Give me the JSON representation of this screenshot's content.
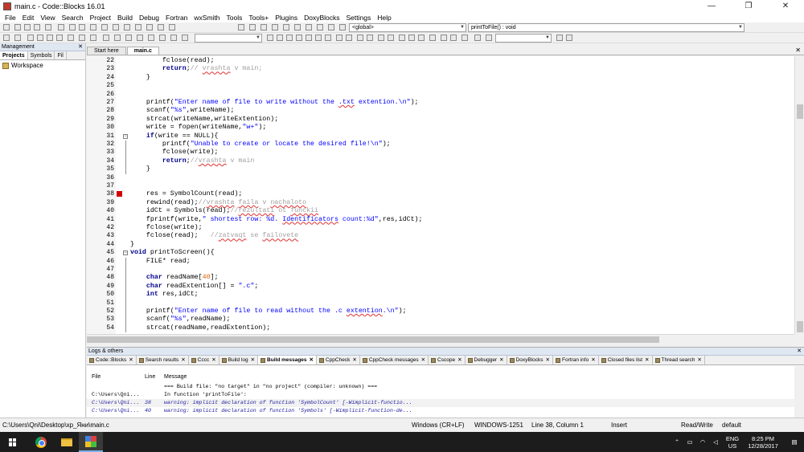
{
  "window": {
    "title": "main.c - Code::Blocks 16.01",
    "minimize": "—",
    "maximize": "❐",
    "close": "✕"
  },
  "menu": [
    "File",
    "Edit",
    "View",
    "Search",
    "Project",
    "Build",
    "Debug",
    "Fortran",
    "wxSmith",
    "Tools",
    "Tools+",
    "Plugins",
    "DoxyBlocks",
    "Settings",
    "Help"
  ],
  "toolbar": {
    "scope_combo": "<global>",
    "function_combo": "printToFile() : void"
  },
  "management": {
    "title": "Management",
    "tabs": [
      "Projects",
      "Symbols",
      "Fil"
    ],
    "active_tab": "Projects",
    "workspace": "Workspace"
  },
  "editor": {
    "tabs": [
      "Start here",
      "main.c"
    ],
    "active_tab": "main.c",
    "breakpoint_line": 38,
    "lines": [
      {
        "n": "22",
        "segs": [
          [
            "t",
            "        fclose(read);"
          ]
        ]
      },
      {
        "n": "23",
        "segs": [
          [
            "kw",
            "        return"
          ],
          [
            "t",
            ";"
          ],
          [
            "cm",
            "// "
          ],
          [
            "cme",
            "vrashta"
          ],
          [
            "cm",
            " v main;"
          ]
        ]
      },
      {
        "n": "24",
        "segs": [
          [
            "t",
            "    }"
          ]
        ]
      },
      {
        "n": "25",
        "segs": [
          [
            "t",
            ""
          ]
        ]
      },
      {
        "n": "26",
        "segs": [
          [
            "t",
            ""
          ]
        ]
      },
      {
        "n": "27",
        "segs": [
          [
            "t",
            "    printf("
          ],
          [
            "str",
            "\"Enter name of file to write without the "
          ],
          [
            "stre",
            ".txt"
          ],
          [
            "str",
            " extention.\\n\""
          ],
          [
            "t",
            ");"
          ]
        ]
      },
      {
        "n": "28",
        "segs": [
          [
            "t",
            "    scanf("
          ],
          [
            "str",
            "\"%s\""
          ],
          [
            "t",
            ",writeName);"
          ]
        ]
      },
      {
        "n": "29",
        "segs": [
          [
            "t",
            "    strcat(writeName,writeExtention);"
          ]
        ]
      },
      {
        "n": "30",
        "segs": [
          [
            "t",
            "    write = fopen(writeName,"
          ],
          [
            "str",
            "\"w+\""
          ],
          [
            "t",
            ");"
          ]
        ]
      },
      {
        "n": "31",
        "segs": [
          [
            "kw",
            "    if"
          ],
          [
            "t",
            "(write == NULL){"
          ]
        ]
      },
      {
        "n": "32",
        "segs": [
          [
            "t",
            "        printf("
          ],
          [
            "str",
            "\"Unable to create or locate the desired file!\\n\""
          ],
          [
            "t",
            ");"
          ]
        ]
      },
      {
        "n": "33",
        "segs": [
          [
            "t",
            "        fclose(write);"
          ]
        ]
      },
      {
        "n": "34",
        "segs": [
          [
            "kw",
            "        return"
          ],
          [
            "t",
            ";"
          ],
          [
            "cm",
            "//"
          ],
          [
            "cme",
            "vrashta"
          ],
          [
            "cm",
            " v main"
          ]
        ]
      },
      {
        "n": "35",
        "segs": [
          [
            "t",
            "    }"
          ]
        ]
      },
      {
        "n": "36",
        "segs": [
          [
            "t",
            ""
          ]
        ]
      },
      {
        "n": "37",
        "segs": [
          [
            "t",
            ""
          ]
        ]
      },
      {
        "n": "38",
        "segs": [
          [
            "t",
            "    res = SymbolCount(read);"
          ]
        ]
      },
      {
        "n": "39",
        "segs": [
          [
            "t",
            "    rewind(read);"
          ],
          [
            "cm",
            "//"
          ],
          [
            "cme",
            "vrashta"
          ],
          [
            "cm",
            " "
          ],
          [
            "cme",
            "faila"
          ],
          [
            "cm",
            " v "
          ],
          [
            "cme",
            "nachaloto"
          ]
        ]
      },
      {
        "n": "40",
        "segs": [
          [
            "t",
            "    idCt = Symbols(read);"
          ],
          [
            "cm",
            "//"
          ],
          [
            "cme",
            "rezultati"
          ],
          [
            "cm",
            " ot "
          ],
          [
            "cme",
            "funckii"
          ]
        ]
      },
      {
        "n": "41",
        "segs": [
          [
            "t",
            "    fprintf(write,"
          ],
          [
            "str",
            "\" shortest row: %d. "
          ],
          [
            "stre",
            "Identificators"
          ],
          [
            "str",
            " count:%d\""
          ],
          [
            "t",
            ",res,idCt);"
          ]
        ]
      },
      {
        "n": "42",
        "segs": [
          [
            "t",
            "    fclose(write);"
          ]
        ]
      },
      {
        "n": "43",
        "segs": [
          [
            "t",
            "    fclose(read);   "
          ],
          [
            "cm",
            "//"
          ],
          [
            "cme",
            "zatvaqt"
          ],
          [
            "cm",
            " se "
          ],
          [
            "cme",
            "failovete"
          ]
        ]
      },
      {
        "n": "44",
        "segs": [
          [
            "t",
            "}"
          ]
        ]
      },
      {
        "n": "45",
        "segs": [
          [
            "kw",
            "void"
          ],
          [
            "t",
            " printToScreen(){"
          ]
        ]
      },
      {
        "n": "46",
        "segs": [
          [
            "t",
            "    FILE* read;"
          ]
        ]
      },
      {
        "n": "47",
        "segs": [
          [
            "t",
            ""
          ]
        ]
      },
      {
        "n": "48",
        "segs": [
          [
            "kw",
            "    char"
          ],
          [
            "t",
            " readName["
          ],
          [
            "num",
            "40"
          ],
          [
            "t",
            "];"
          ]
        ]
      },
      {
        "n": "49",
        "segs": [
          [
            "kw",
            "    char"
          ],
          [
            "t",
            " readExtention[] = "
          ],
          [
            "str",
            "\".c\""
          ],
          [
            "t",
            ";"
          ]
        ]
      },
      {
        "n": "50",
        "segs": [
          [
            "kw",
            "    int"
          ],
          [
            "t",
            " res,idCt;"
          ]
        ]
      },
      {
        "n": "51",
        "segs": [
          [
            "t",
            ""
          ]
        ]
      },
      {
        "n": "52",
        "segs": [
          [
            "t",
            "    printf("
          ],
          [
            "str",
            "\"Enter name of file to read without the .c "
          ],
          [
            "stre",
            "extention"
          ],
          [
            "str",
            ".\\n\""
          ],
          [
            "t",
            ");"
          ]
        ]
      },
      {
        "n": "53",
        "segs": [
          [
            "t",
            "    scanf("
          ],
          [
            "str",
            "\"%s\""
          ],
          [
            "t",
            ",readName);"
          ]
        ]
      },
      {
        "n": "54",
        "segs": [
          [
            "t",
            "    strcat(readName,readExtention);"
          ]
        ]
      }
    ]
  },
  "logs": {
    "title": "Logs & others",
    "tabs": [
      "Code::Blocks",
      "Search results",
      "Cccc",
      "Build log",
      "Build messages",
      "CppCheck",
      "CppCheck messages",
      "Cscope",
      "Debugger",
      "DoxyBlocks",
      "Fortran info",
      "Closed files list",
      "Thread search"
    ],
    "active_tab": "Build messages",
    "columns": [
      "File",
      "Line",
      "Message"
    ],
    "rows": [
      {
        "file": "",
        "line": "",
        "msg": "=== Build file: \"no target\" in \"no project\" (compiler: unknown) ===",
        "kind": "info"
      },
      {
        "file": "C:\\Users\\Qni...",
        "line": "",
        "msg": "In function 'printToFile':",
        "kind": "info"
      },
      {
        "file": "C:\\Users\\Qni...",
        "line": "38",
        "msg": "warning: implicit declaration of function 'SymbolCount' [-Wimplicit-functio...",
        "kind": "warn"
      },
      {
        "file": "C:\\Users\\Qni...",
        "line": "40",
        "msg": "warning: implicit declaration of function 'Symbols' [-Wimplicit-function-de...",
        "kind": "warn"
      }
    ]
  },
  "status": {
    "path": "C:\\Users\\Qni\\Desktop\\xp_Яни\\main.c",
    "eol": "Windows (CR+LF)",
    "encoding": "WINDOWS-1251",
    "position": "Line 38, Column 1",
    "mode": "Insert",
    "access": "Read/Write",
    "profile": "default"
  },
  "taskbar": {
    "lang": "ENG",
    "region": "US",
    "time": "8:25 PM",
    "date": "12/28/2017"
  },
  "colors": {
    "keyword": "#00008b",
    "string": "#0000ff",
    "comment": "#a0a0a0",
    "breakpoint": "#d00000"
  }
}
